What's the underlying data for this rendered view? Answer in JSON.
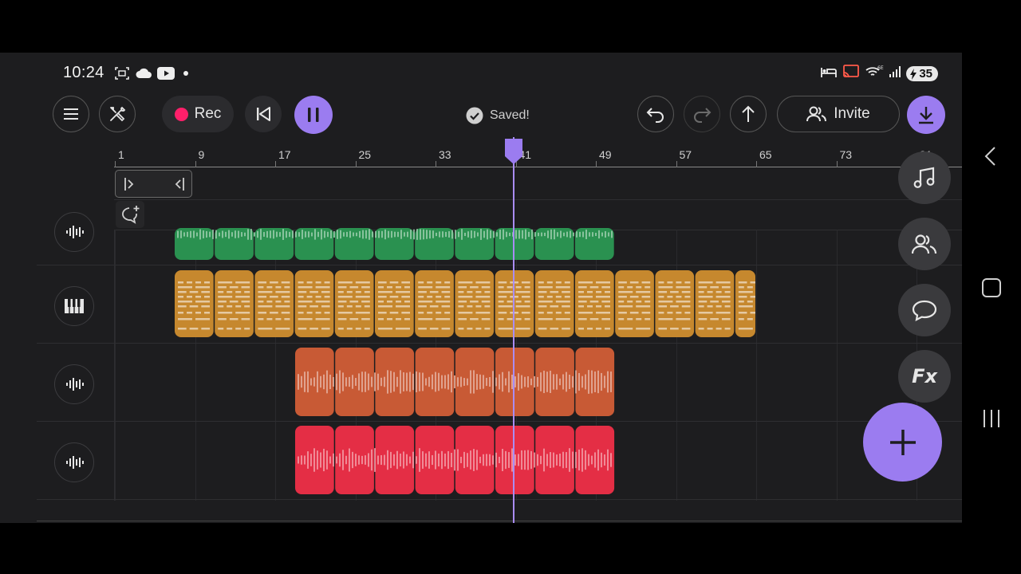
{
  "status_bar": {
    "time": "10:24",
    "battery": "35",
    "left_icons": [
      "screenshot-icon",
      "cloud-icon",
      "youtube-icon",
      "dot-icon"
    ],
    "right_icons": [
      "bed-icon",
      "cast-icon",
      "wifi-6e-icon",
      "signal-icon",
      "battery-icon"
    ],
    "wifi_label": "6E"
  },
  "toolbar": {
    "rec_label": "Rec",
    "saved_label": "Saved!",
    "invite_label": "Invite",
    "rec_color": "#ff1f6a",
    "accent": "#9b7cf0"
  },
  "ruler": {
    "labels": [
      "1",
      "9",
      "17",
      "25",
      "33",
      "41",
      "49",
      "57",
      "65",
      "73",
      "81"
    ]
  },
  "tracks": [
    {
      "icon": "waveform-icon",
      "clip_color": "#2a9150"
    },
    {
      "icon": "piano-icon",
      "clip_color": "#c6882e"
    },
    {
      "icon": "waveform-icon",
      "clip_color": "#c85a35"
    },
    {
      "icon": "waveform-icon",
      "clip_color": "#e42e45"
    }
  ],
  "side_panel": {
    "buttons": [
      "music-note-icon",
      "collaborators-icon",
      "chat-icon",
      "fx-icon"
    ],
    "fx_label": "Fx"
  }
}
